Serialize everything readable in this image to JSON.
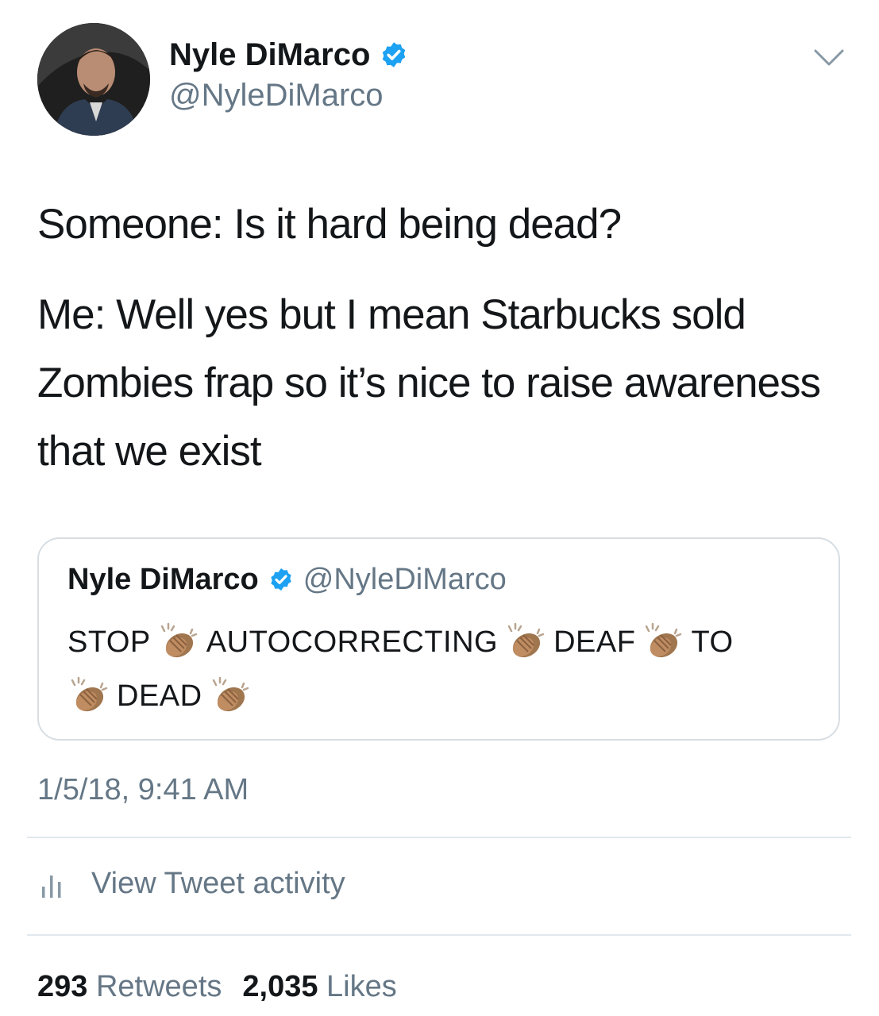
{
  "author": {
    "display_name": "Nyle DiMarco",
    "handle": "@NyleDiMarco",
    "verified": true
  },
  "tweet": {
    "paragraphs": [
      "Someone: Is it hard being dead?",
      "Me: Well yes but I mean Starbucks sold Zombies frap so it’s nice to raise awareness that we exist"
    ]
  },
  "quoted_tweet": {
    "display_name": "Nyle DiMarco",
    "handle": "@NyleDiMarco",
    "words": [
      "STOP",
      "AUTOCORRECTING",
      "DEAF",
      "TO",
      "DEAD"
    ]
  },
  "timestamp": "1/5/18, 9:41 AM",
  "activity": {
    "label": "View Tweet activity"
  },
  "stats": {
    "retweets_count": "293",
    "retweets_label": "Retweets",
    "likes_count": "2,035",
    "likes_label": "Likes"
  },
  "colors": {
    "text": "#14171a",
    "secondary": "#657786",
    "verified_blue": "#1da1f2",
    "border": "#d7dee3"
  },
  "icons": [
    "verified-badge-icon",
    "chevron-down-icon",
    "clapping-hands-icon",
    "activity-bars-icon"
  ]
}
